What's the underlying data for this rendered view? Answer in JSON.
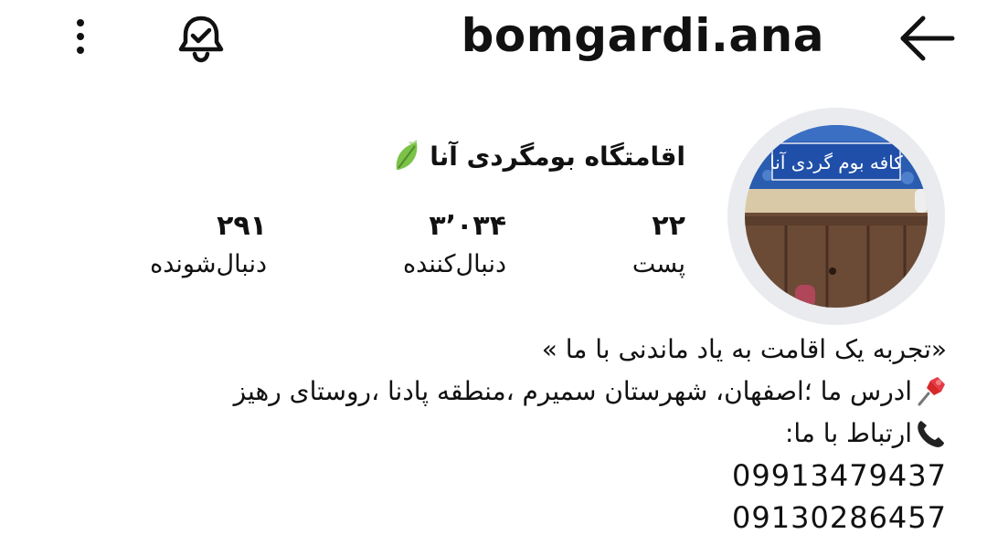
{
  "header": {
    "username": "bomgardi.ana",
    "icons": {
      "more": "more-vertical-icon",
      "notifications": "bell-check-icon",
      "back": "arrow-left-icon"
    }
  },
  "profile": {
    "display_name": "اقامتگاه بومگردی آنا",
    "avatar_sign_text": "کافه بوم گردی آنا",
    "stats": {
      "posts": {
        "value": "۲۲",
        "label": "پست"
      },
      "followers": {
        "value": "۳٬۰۳۴",
        "label": "دنبال‌کننده"
      },
      "following": {
        "value": "۲۹۱",
        "label": "دنبال‌شونده"
      }
    }
  },
  "bio": {
    "line1": "«تجربه یک اقامت به یاد ماندنی با ما »",
    "line2": "ادرس ما ؛اصفهان، شهرستان سمیرم ،منطقه پادنا ،روستای رهیز",
    "line3": "ارتباط با ما:",
    "phone1": "09913479437",
    "phone2": "09130286457"
  },
  "colors": {
    "text": "#111111",
    "avatar_ring": "#e9ebee",
    "sign_blue": "#1f4fa8",
    "door_brown": "#6b4a36"
  }
}
